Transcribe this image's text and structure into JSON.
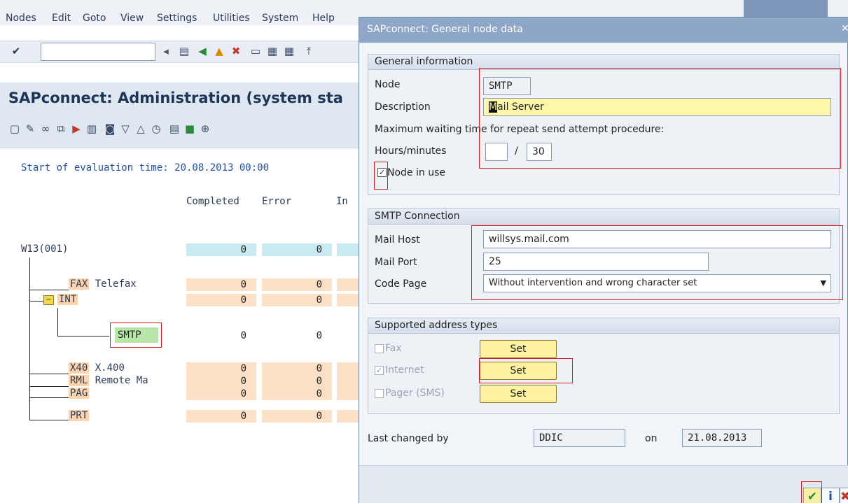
{
  "menubar": {
    "items": [
      "Nodes",
      "Edit",
      "Goto",
      "View",
      "Settings",
      "Utilities",
      "System",
      "Help"
    ]
  },
  "main": {
    "title": "SAPconnect: Administration (system sta",
    "eval_label": "Start of evaluation time: 20.08.2013 00:00",
    "columns": [
      "Completed",
      "Error",
      "In"
    ],
    "root": {
      "name": "W13(001)",
      "completed": "0",
      "error": "0"
    },
    "nodes": [
      {
        "code": "FAX",
        "desc": "Telefax",
        "completed": "0",
        "error": "0"
      },
      {
        "code": "INT",
        "desc": "",
        "completed": "0",
        "error": "0"
      },
      {
        "code": "SMTP",
        "desc": "",
        "completed": "0",
        "error": "0"
      },
      {
        "code": "X40",
        "desc": "X.400",
        "completed": "0",
        "error": "0"
      },
      {
        "code": "RML",
        "desc": "Remote Ma",
        "completed": "0",
        "error": "0"
      },
      {
        "code": "PAG",
        "desc": "",
        "completed": "0",
        "error": "0"
      },
      {
        "code": "PRT",
        "desc": "",
        "completed": "0",
        "error": "0"
      }
    ]
  },
  "dialog": {
    "title": "SAPconnect: General node data",
    "general": {
      "heading": "General information",
      "node_label": "Node",
      "node_value": "SMTP",
      "desc_label": "Description",
      "desc_cursor": "M",
      "desc_value": "ail Server",
      "waiting_label": "Maximum waiting time for repeat send attempt procedure:",
      "hours_label": "Hours/minutes",
      "hours_value": "",
      "slash": "/",
      "minutes_value": "30",
      "node_in_use_label": "Node in use",
      "node_in_use_checked": true
    },
    "smtp": {
      "heading": "SMTP Connection",
      "host_label": "Mail Host",
      "host_value": "willsys.mail.com",
      "port_label": "Mail Port",
      "port_value": "25",
      "codepage_label": "Code Page",
      "codepage_value": "Without intervention and wrong character set"
    },
    "address_types": {
      "heading": "Supported address types",
      "items": [
        {
          "label": "Fax",
          "checked": false,
          "button": "Set"
        },
        {
          "label": "Internet",
          "checked": true,
          "button": "Set"
        },
        {
          "label": "Pager (SMS)",
          "checked": false,
          "button": "Set"
        }
      ]
    },
    "last_changed": {
      "label": "Last changed by",
      "user": "DDIC",
      "on_label": "on",
      "date": "21.08.2013"
    }
  },
  "colors": {
    "accent": "#8ea6c8",
    "highlight_red": "#d02020",
    "set_button": "#fff2a0",
    "node_green": "#b8e5a8"
  }
}
